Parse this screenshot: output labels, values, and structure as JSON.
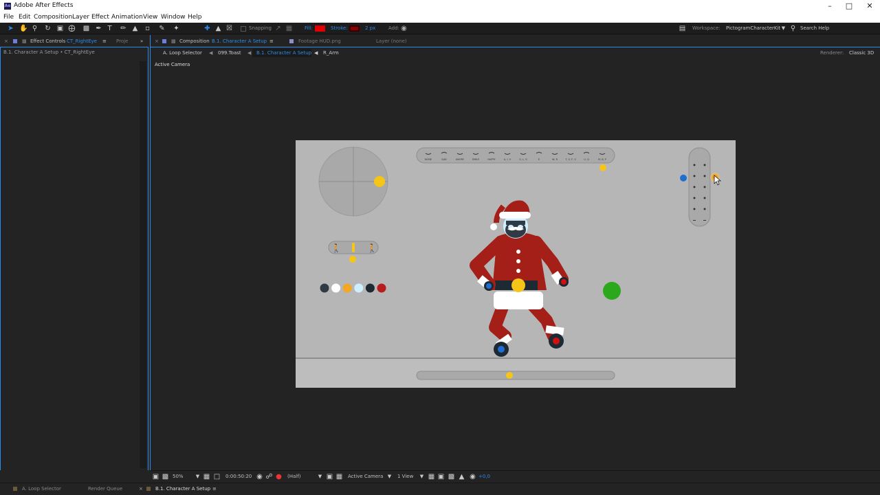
{
  "window": {
    "title": "Adobe After Effects",
    "app_icon": "Ae"
  },
  "menu": [
    "File",
    "Edit",
    "Composition",
    "Layer",
    "Effect",
    "Animation",
    "View",
    "Window",
    "Help"
  ],
  "toolbar": {
    "snapping_label": "Snapping",
    "fill_label": "Fill:",
    "stroke_label": "Stroke:",
    "stroke_size": "2 px",
    "add_label": "Add:",
    "workspace_label": "Workspace:",
    "workspace_value": "PictogramCharacterKit",
    "search_placeholder": "Search Help",
    "fill_color": "#e00000",
    "stroke_color": "#8a0000"
  },
  "left_panel": {
    "tab_effect_controls": "Effect Controls",
    "tab_effect_target": "CT_RightEye",
    "tab_project": "Proje",
    "breadcrumb": "B.1. Character A Setup • CT_RightEye"
  },
  "comp_panel": {
    "tab_composition_label": "Composition",
    "tab_composition_name": "B.1. Character A Setup",
    "tab_footage": "Footage HUD.png",
    "tab_layer": "Layer (none)",
    "flow": [
      "A. Loop Selector",
      "099.Toast",
      "B.1. Character A Setup",
      "R_Arm"
    ],
    "renderer_label": "Renderer:",
    "renderer_value": "Classic 3D",
    "active_camera_label": "Active Camera"
  },
  "viewer_bar": {
    "zoom": "50%",
    "timecode": "0:00:50:20",
    "resolution": "(Half)",
    "camera": "Active Camera",
    "views": "1 View",
    "exposure": "+0,0"
  },
  "bottom_tabs": [
    "A. Loop Selector",
    "Render Queue",
    "B.1. Character A Setup"
  ],
  "mouth_labels": [
    "NONE",
    "SAD",
    "ANGRY",
    "SMILE",
    "HAPPY",
    "A, I, V",
    "O, L, G",
    "E",
    "W, R",
    "T, S, F, V",
    "U, Q",
    "M, B, P"
  ],
  "palette": [
    "#2f3a45",
    "#ffffff",
    "#f5a623",
    "#cfefff",
    "#1e2a33",
    "#b81c1c"
  ],
  "colors": {
    "accent": "#2d8ceb",
    "artboard": "#b6b6b6",
    "santa_red": "#a31f17",
    "yellow_handle": "#f5c518",
    "green_handle": "#2ca81c",
    "blue_handle": "#1f6fd1"
  }
}
